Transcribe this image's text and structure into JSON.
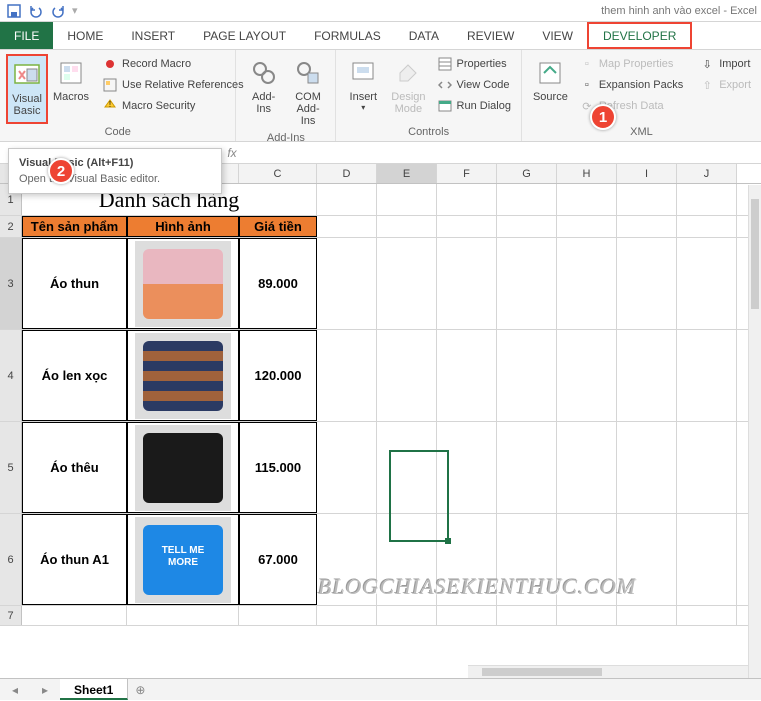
{
  "title": "them hinh anh vào excel - Excel",
  "qat": [
    "save-icon",
    "undo-icon",
    "redo-icon"
  ],
  "tabs": {
    "file": "FILE",
    "list": [
      "HOME",
      "INSERT",
      "PAGE LAYOUT",
      "FORMULAS",
      "DATA",
      "REVIEW",
      "VIEW",
      "DEVELOPER"
    ]
  },
  "ribbon": {
    "code": {
      "visual_basic": "Visual\nBasic",
      "macros": "Macros",
      "record": "Record Macro",
      "relative": "Use Relative References",
      "security": "Macro Security",
      "label": "Code"
    },
    "addins": {
      "addins": "Add-Ins",
      "com": "COM\nAdd-Ins",
      "label": "Add-Ins"
    },
    "controls": {
      "insert": "Insert",
      "design": "Design\nMode",
      "properties": "Properties",
      "viewcode": "View Code",
      "rundialog": "Run Dialog",
      "label": "Controls"
    },
    "xml": {
      "source": "Source",
      "mapprops": "Map Properties",
      "expansion": "Expansion Packs",
      "refresh": "Refresh Data",
      "import": "Import",
      "export": "Export",
      "label": "XML"
    }
  },
  "tooltip": {
    "title": "Visual Basic (Alt+F11)",
    "body": "Open the Visual Basic editor."
  },
  "callouts": {
    "c1": "1",
    "c2": "2"
  },
  "formula": {
    "fx": "fx",
    "value": ""
  },
  "columns": {
    "A": 105,
    "B": 112,
    "C": 78,
    "D": 60,
    "E": 60,
    "F": 60,
    "G": 60,
    "H": 60,
    "I": 60,
    "J": 60
  },
  "sheet": {
    "title_row": {
      "h": 1,
      "text": "Danh sách hàng"
    },
    "header_row": {
      "h": 2,
      "cells": [
        "Tên sản phẩm",
        "Hình ảnh",
        "Giá tiền"
      ]
    },
    "rows": [
      {
        "h": 3,
        "name": "Áo thun",
        "price": "89.000",
        "imgclass": "s1"
      },
      {
        "h": 4,
        "name": "Áo len xọc",
        "price": "120.000",
        "imgclass": "s2"
      },
      {
        "h": 5,
        "name": "Áo  thêu",
        "price": "115.000",
        "imgclass": "s3"
      },
      {
        "h": 6,
        "name": "Áo thun A1",
        "price": "67.000",
        "imgclass": "s4",
        "imgtext": "TELL ME\nMORE"
      }
    ]
  },
  "watermark": "BLOGCHIASEKIENTHUC.COM",
  "tabs_bottom": {
    "active": "Sheet1"
  }
}
